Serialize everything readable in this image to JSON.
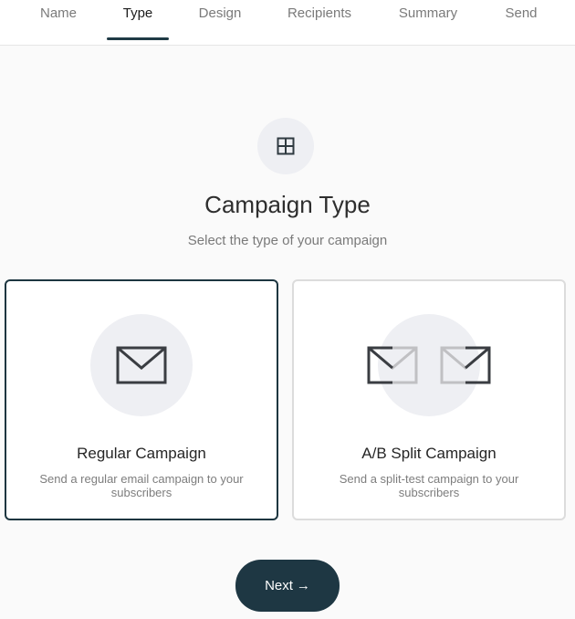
{
  "tabs": [
    {
      "label": "Name",
      "active": false
    },
    {
      "label": "Type",
      "active": true
    },
    {
      "label": "Design",
      "active": false
    },
    {
      "label": "Recipients",
      "active": false
    },
    {
      "label": "Summary",
      "active": false
    },
    {
      "label": "Send",
      "active": false
    }
  ],
  "header": {
    "icon": "grid-icon",
    "title": "Campaign Type",
    "subtitle": "Select the type of your campaign"
  },
  "options": [
    {
      "title": "Regular Campaign",
      "description": "Send a regular email campaign to your subscribers",
      "icon": "envelope-icon",
      "selected": true
    },
    {
      "title": "A/B Split Campaign",
      "description": "Send a split-test campaign to your subscribers",
      "icon": "split-envelopes-icon",
      "selected": false
    }
  ],
  "footer": {
    "next_label": "Next",
    "next_arrow": "→"
  },
  "colors": {
    "accent": "#1e3743",
    "selected_border": "#1d3640",
    "icon_bg": "#eeeff3"
  }
}
